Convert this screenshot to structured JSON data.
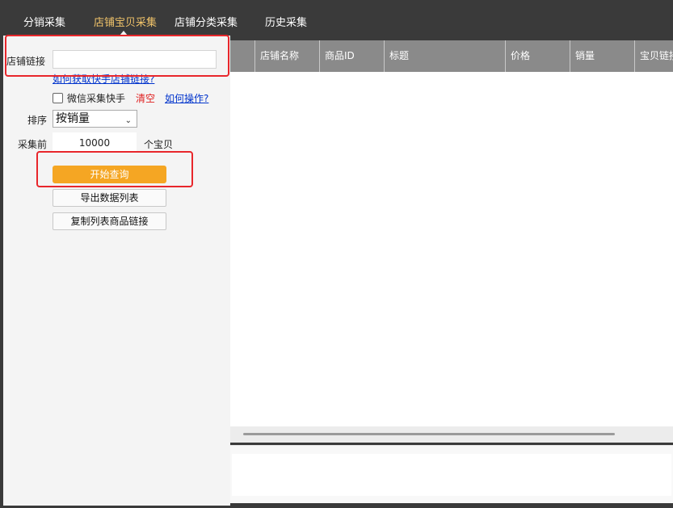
{
  "nav": {
    "tabs": [
      {
        "label": "分销采集",
        "active": false
      },
      {
        "label": "店铺宝贝采集",
        "active": true
      },
      {
        "label": "店铺分类采集",
        "active": false
      },
      {
        "label": "历史采集",
        "active": false
      }
    ]
  },
  "form": {
    "shop_link_label": "店铺链接",
    "shop_link_value": "",
    "help_link": "如何获取快手店铺链接?",
    "wechat_checkbox_label": "微信采集快手",
    "wechat_checked": false,
    "clear_link": "清空",
    "howto_link": "如何操作?",
    "sort_label": "排序",
    "sort_value": "按销量",
    "collect_prefix": "采集前",
    "collect_count": "10000",
    "collect_suffix": "个宝贝",
    "start_button": "开始查询",
    "export_button": "导出数据列表",
    "copy_button": "复制列表商品链接"
  },
  "table": {
    "columns": [
      "",
      "店铺名称",
      "商品ID",
      "标题",
      "价格",
      "销量",
      "宝贝链接"
    ]
  },
  "colors": {
    "topbar_bg": "#3a3a3a",
    "active_tab": "#f0c36a",
    "primary_button": "#f5a623",
    "highlight_box": "#e8262b",
    "table_header": "#8a8a8a"
  }
}
